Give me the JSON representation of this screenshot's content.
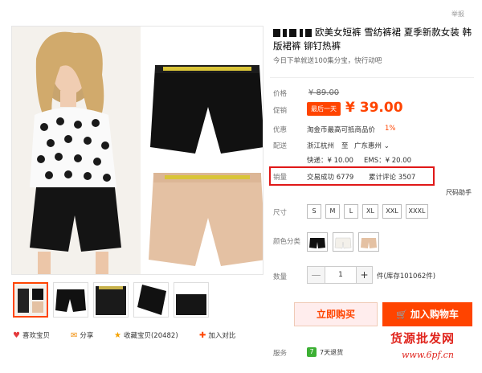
{
  "header": {
    "report": "举报"
  },
  "product": {
    "title": "欧美女短裤 雪纺裤裙 夏季新款女装 韩版裙裤 铆钉热裤",
    "subtitle": "今日下单就送100集分宝，快行动吧"
  },
  "labels": {
    "price": "价格",
    "promo": "促销",
    "perk": "优惠",
    "shipping": "配送",
    "sales": "销量",
    "size": "尺寸",
    "color": "颜色分类",
    "quantity": "数量",
    "service": "服务"
  },
  "price": {
    "original": "¥ 89.00",
    "promo_badge": "最后一天",
    "promo": "¥ 39.00"
  },
  "perk": {
    "text": "淘金币最高可抵商品价",
    "percent": "1%"
  },
  "shipping": {
    "from": "浙江杭州",
    "to_word": "至",
    "dest": "广东惠州 ⌄",
    "express": "快递：¥ 10.00",
    "ems": "EMS：¥ 20.00"
  },
  "sales": {
    "deals": "交易成功 6779",
    "reviews": "累计评论 3507"
  },
  "size_helper": "尺码助手",
  "sizes": [
    "S",
    "M",
    "L",
    "XL",
    "XXL",
    "XXXL"
  ],
  "colors": [
    "black",
    "white",
    "beige"
  ],
  "quantity": {
    "minus": "—",
    "value": "1",
    "plus": "+",
    "stock": "件(库存101062件)"
  },
  "buttons": {
    "buy_now": "立即购买",
    "add_to_cart": "加入购物车"
  },
  "service": {
    "badge": "7",
    "text": "7天退货"
  },
  "actions": {
    "like": "喜欢宝贝",
    "share": "分享",
    "favorite": "收藏宝贝(20482)",
    "compare": "加入对比"
  },
  "watermark": {
    "text": "货源批发网",
    "url": "www.6pf.cn"
  },
  "colors_theme": {
    "accent": "#ff4400",
    "highlight_box": "#e01818",
    "watermark": "#e0251d"
  }
}
